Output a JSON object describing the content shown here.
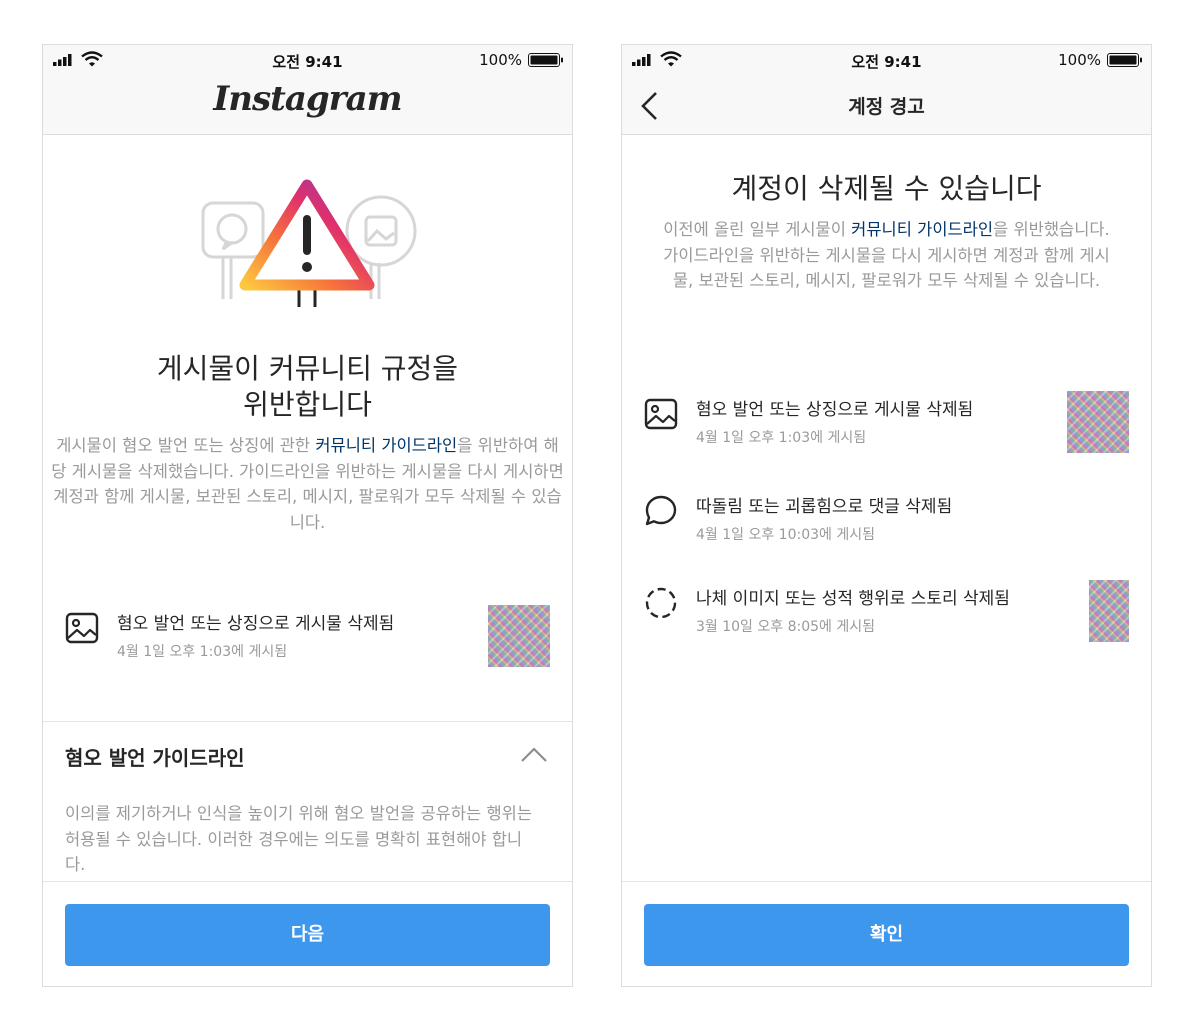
{
  "status_bar": {
    "time": "오전 9:41",
    "battery": "100%"
  },
  "left_screen": {
    "logo": "Instagram",
    "heading_line1": "게시물이 커뮤니티 규정을",
    "heading_line2": "위반합니다",
    "description": {
      "before_link": "게시물이 혐오 발언 또는 상징에 관한 ",
      "link": "커뮤니티 가이드라인",
      "after_link": "을 위반하여 해당 게시물을 삭제했습니다. 가이드라인을 위반하는 게시물을 다시 게시하면 계정과 함께 게시물, 보관된 스토리, 메시지, 팔로워가 모두 삭제될 수 있습니다."
    },
    "item": {
      "icon": "image-icon",
      "title": "혐오 발언 또는 상징으로 게시물 삭제됨",
      "date": "4월 1일 오후 1:03에 게시됨"
    },
    "guideline": {
      "title": "혐오 발언 가이드라인",
      "text": "이의를 제기하거나 인식을 높이기 위해 혐오 발언을 공유하는 행위는 허용될 수 있습니다. 이러한 경우에는 의도를 명확히 표현해야 합니다."
    },
    "button": "다음"
  },
  "right_screen": {
    "title": "계정 경고",
    "heading": "계정이 삭제될 수 있습니다",
    "description": {
      "before_link": "이전에 올린 일부 게시물이 ",
      "link": "커뮤니티 가이드라인",
      "after_link": "을 위반했습니다. 가이드라인을 위반하는 게시물을 다시 게시하면 계정과 함께 게시물, 보관된 스토리, 메시지, 팔로워가 모두 삭제될 수 있습니다."
    },
    "items": [
      {
        "icon": "image-icon",
        "title": "혐오 발언 또는 상징으로 게시물 삭제됨",
        "date": "4월 1일 오후 1:03에 게시됨"
      },
      {
        "icon": "comment-icon",
        "title": "따돌림 또는 괴롭힘으로 댓글 삭제됨",
        "date": "4월 1일 오후 10:03에 게시됨"
      },
      {
        "icon": "story-icon",
        "title": "나체 이미지 또는 성적 행위로 스토리 삭제됨",
        "date": "3월 10일 오후 8:05에 게시됨"
      }
    ],
    "button": "확인"
  },
  "colors": {
    "button": "#3d97ec",
    "link": "#003569",
    "secondary_text": "#9a9a9a",
    "bar_background": "#f8f8f8"
  }
}
